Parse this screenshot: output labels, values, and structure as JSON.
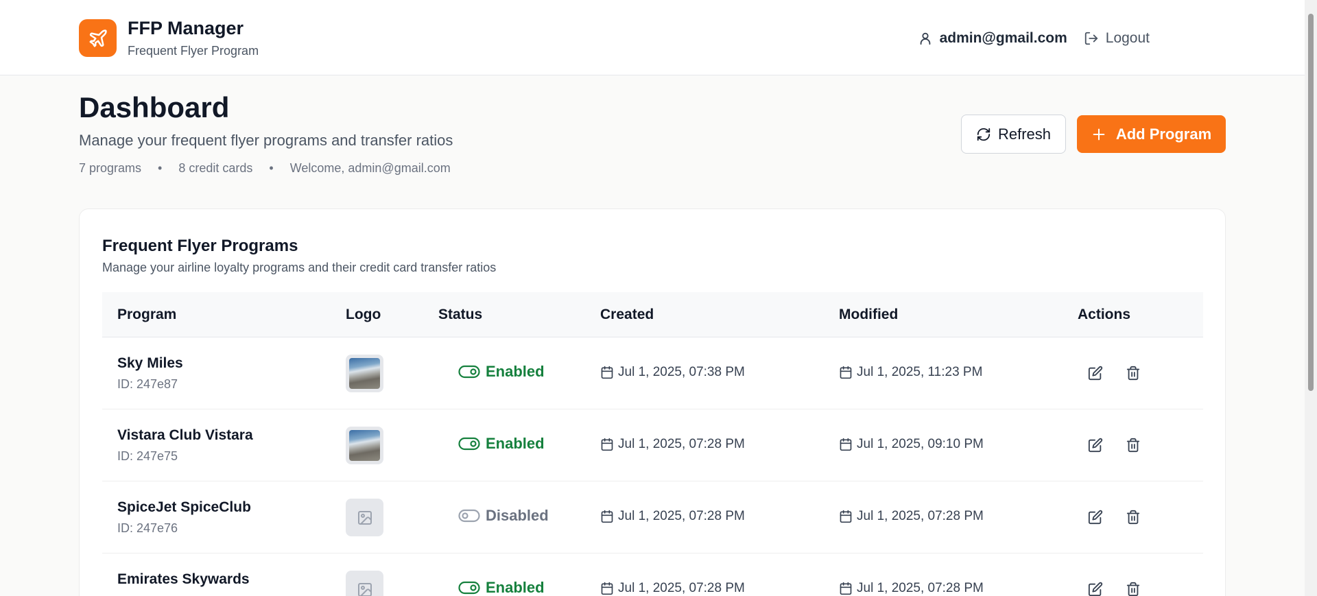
{
  "header": {
    "brand_title": "FFP Manager",
    "brand_subtitle": "Frequent Flyer Program",
    "brand_icon": "plane-icon",
    "user_email": "admin@gmail.com",
    "logout_label": "Logout"
  },
  "page": {
    "title": "Dashboard",
    "subtitle": "Manage your frequent flyer programs and transfer ratios",
    "meta": {
      "programs": "7 programs",
      "cards": "8 credit cards",
      "welcome": "Welcome, admin@gmail.com"
    },
    "refresh_label": "Refresh",
    "add_label": "Add Program"
  },
  "table": {
    "title": "Frequent Flyer Programs",
    "subtitle": "Manage your airline loyalty programs and their credit card transfer ratios",
    "columns": {
      "program": "Program",
      "logo": "Logo",
      "status": "Status",
      "created": "Created",
      "modified": "Modified",
      "actions": "Actions"
    },
    "rows": [
      {
        "name": "Sky Miles",
        "id": "ID: 247e87",
        "logo": "photo",
        "status": "Enabled",
        "created": "Jul 1, 2025, 07:38 PM",
        "modified": "Jul 1, 2025, 11:23 PM"
      },
      {
        "name": "Vistara Club Vistara",
        "id": "ID: 247e75",
        "logo": "photo",
        "status": "Enabled",
        "created": "Jul 1, 2025, 07:28 PM",
        "modified": "Jul 1, 2025, 09:10 PM"
      },
      {
        "name": "SpiceJet SpiceClub",
        "id": "ID: 247e76",
        "logo": "placeholder",
        "status": "Disabled",
        "created": "Jul 1, 2025, 07:28 PM",
        "modified": "Jul 1, 2025, 07:28 PM"
      },
      {
        "name": "Emirates Skywards",
        "id": "",
        "logo": "placeholder",
        "status": "Enabled",
        "created": "Jul 1, 2025, 07:28 PM",
        "modified": "Jul 1, 2025, 07:28 PM"
      }
    ]
  },
  "colors": {
    "accent": "#f97316",
    "enabled": "#15803d",
    "disabled": "#6b7280"
  }
}
